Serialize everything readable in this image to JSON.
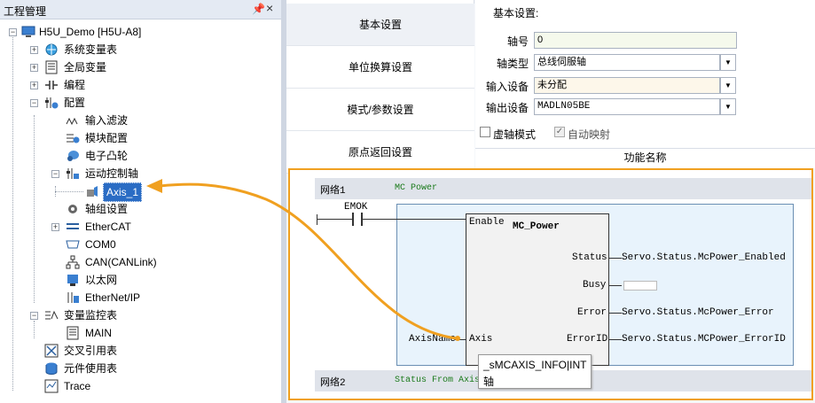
{
  "left_panel": {
    "title": "工程管理",
    "pin": "ᵖ",
    "close": "×",
    "tree": [
      {
        "label": "H5U_Demo [H5U-A8]",
        "icon": "monitor-icon"
      },
      {
        "label": "系统变量表",
        "icon": "globe-icon"
      },
      {
        "label": "全局变量",
        "icon": "table-icon"
      },
      {
        "label": "编程",
        "icon": "ladder-icon"
      },
      {
        "label": "配置",
        "icon": "config-icon"
      },
      {
        "label": "输入滤波",
        "icon": "wave-icon"
      },
      {
        "label": "模块配置",
        "icon": "module-icon"
      },
      {
        "label": "电子凸轮",
        "icon": "cam-icon"
      },
      {
        "label": "运动控制轴",
        "icon": "motion-icon"
      },
      {
        "label": "Axis_1",
        "icon": "axis-icon"
      },
      {
        "label": "轴组设置",
        "icon": "gear-icon"
      },
      {
        "label": "EtherCAT",
        "icon": "ethercat-icon"
      },
      {
        "label": "COM0",
        "icon": "serial-icon"
      },
      {
        "label": "CAN(CANLink)",
        "icon": "can-icon"
      },
      {
        "label": "以太网",
        "icon": "network-icon"
      },
      {
        "label": "EtherNet/IP",
        "icon": "ethernetip-icon"
      },
      {
        "label": "变量监控表",
        "icon": "monitor-table-icon"
      },
      {
        "label": "MAIN",
        "icon": "table-icon"
      },
      {
        "label": "交叉引用表",
        "icon": "crossref-icon"
      },
      {
        "label": "元件使用表",
        "icon": "database-icon"
      },
      {
        "label": "Trace",
        "icon": "trace-icon"
      }
    ]
  },
  "nav": [
    "基本设置",
    "单位换算设置",
    "模式/参数设置",
    "原点返回设置"
  ],
  "form": {
    "title": "基本设置:",
    "axis_no_label": "轴号",
    "axis_no_value": "0",
    "axis_type_label": "轴类型",
    "axis_type_value": "总线伺服轴",
    "input_label": "输入设备",
    "input_value": "未分配",
    "output_label": "输出设备",
    "output_value": "MADLN05BE",
    "virtual_axis": "虚轴模式",
    "auto_map": "自动映射",
    "func_header": "功能名称"
  },
  "ladder": {
    "net1": "网络1",
    "net1_comment": "MC Power",
    "contact": "EMOK",
    "fb_name": "MC_Power",
    "pin_enable": "Enable",
    "pin_status": "Status",
    "pin_busy": "Busy",
    "pin_error": "Error",
    "pin_axis": "Axis",
    "pin_errorid": "ErrorID",
    "out_status": "Servo.Status.McPower_Enabled",
    "out_error": "Servo.Status.McPower_Error",
    "out_errorid": "Servo.Status.MCPower_ErrorID",
    "in_axis": "AxisName",
    "net2": "网络2",
    "net2_comment": "Status From Axis",
    "tooltip_type": "_sMCAXIS_INFO|INT",
    "tooltip_desc": "轴"
  },
  "colors": {
    "highlight": "#f0a020",
    "selected": "#2a6cc4"
  }
}
